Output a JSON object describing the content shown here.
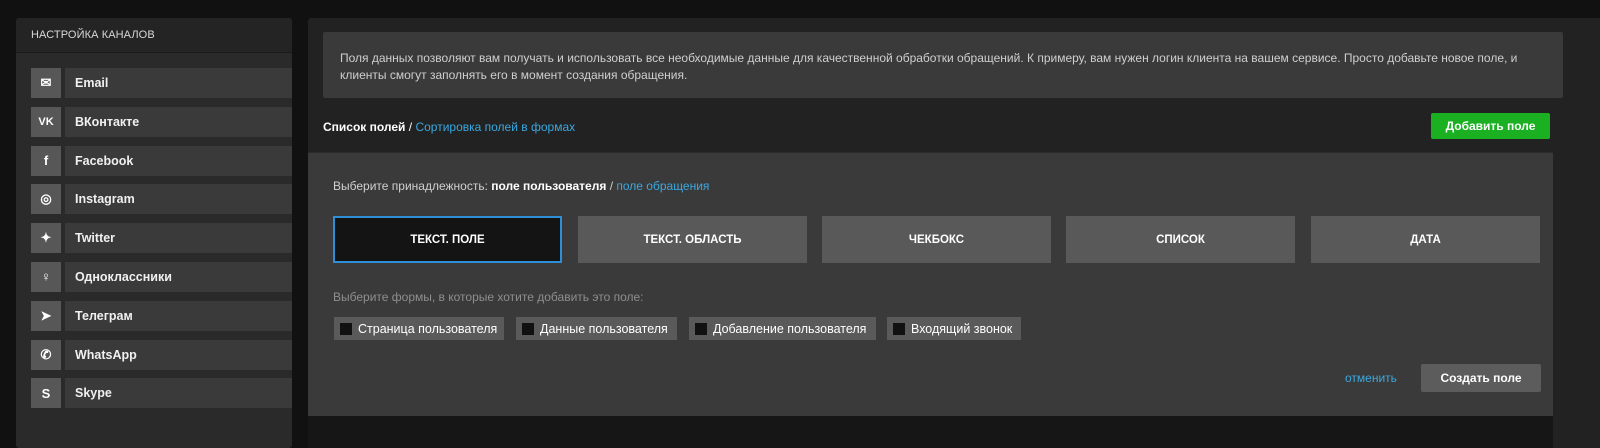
{
  "sidebar": {
    "title": "НАСТРОЙКА КАНАЛОВ",
    "items": [
      {
        "icon": "envelope-icon",
        "glyph": "✉",
        "label": "Email"
      },
      {
        "icon": "vk-icon",
        "glyph": "VK",
        "label": "ВКонтакте"
      },
      {
        "icon": "facebook-icon",
        "glyph": "f",
        "label": "Facebook"
      },
      {
        "icon": "instagram-icon",
        "glyph": "◎",
        "label": "Instagram"
      },
      {
        "icon": "twitter-icon",
        "glyph": "✦",
        "label": "Twitter"
      },
      {
        "icon": "odnoklassniki-icon",
        "glyph": "♀",
        "label": "Одноклассники"
      },
      {
        "icon": "telegram-icon",
        "glyph": "➤",
        "label": "Телеграм"
      },
      {
        "icon": "whatsapp-icon",
        "glyph": "✆",
        "label": "WhatsApp"
      },
      {
        "icon": "skype-icon",
        "glyph": "S",
        "label": "Skype"
      }
    ]
  },
  "main": {
    "info_text": "Поля данных позволяют вам получать и использовать все необходимые данные для качественной обработки обращений. К примеру, вам нужен логин клиента на вашем сервисе. Просто добавьте новое поле, и клиенты смогут заполнять его в момент создания обращения.",
    "fields_nav": {
      "active": "Список полей",
      "separator": " / ",
      "link": "Сортировка полей в формах"
    },
    "add_field_label": "Добавить поле",
    "owner": {
      "prompt": "Выберите принадлежность: ",
      "selected": "поле пользователя",
      "separator": " / ",
      "other": "поле обращения"
    },
    "field_types": [
      "ТЕКСТ. ПОЛЕ",
      "ТЕКСТ. ОБЛАСТЬ",
      "ЧЕКБОКС",
      "СПИСОК",
      "ДАТА"
    ],
    "selected_type": "ТЕКСТ. ПОЛЕ",
    "forms_hint": "Выберите формы, в которые хотите добавить это поле:",
    "forms": [
      "Страница пользователя",
      "Данные пользователя",
      "Добавление пользователя",
      "Входящий звонок"
    ],
    "cancel_label": "отменить",
    "create_label": "Создать поле"
  },
  "colors": {
    "accent_link": "#3aa8e0",
    "add_button": "#1ab022",
    "selected_border": "#2e8fd6"
  }
}
